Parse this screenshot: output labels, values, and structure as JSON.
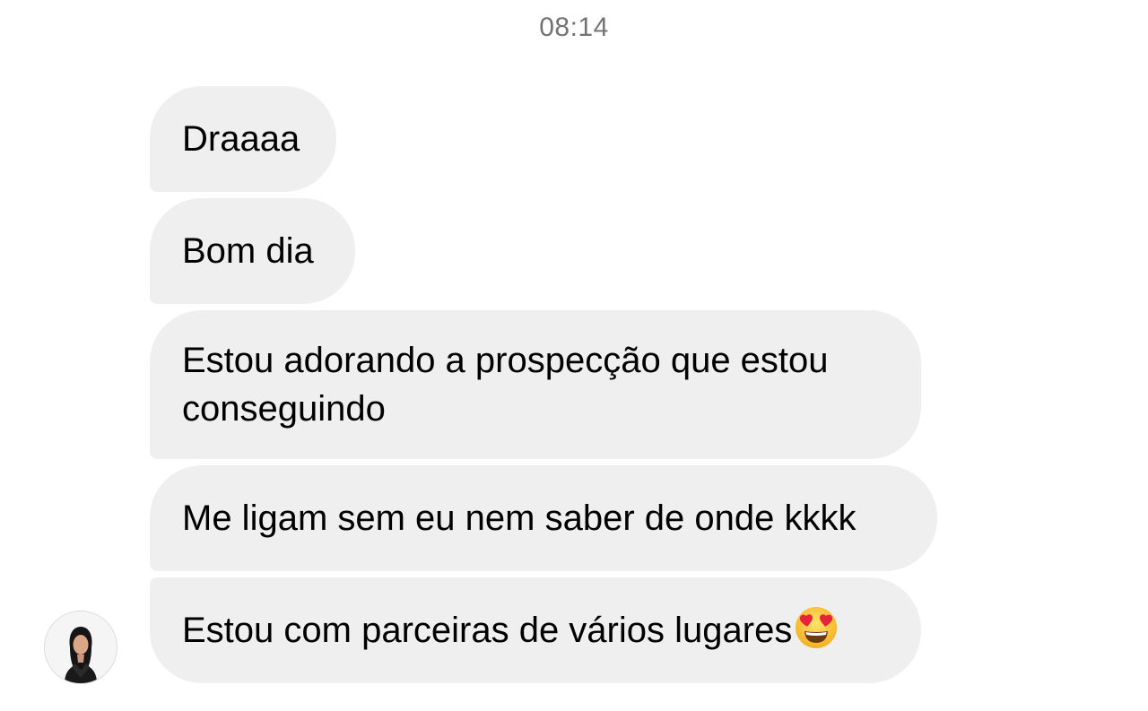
{
  "conversation": {
    "timestamp": "08:14",
    "messages": [
      {
        "text": "Draaaa"
      },
      {
        "text": "Bom dia"
      },
      {
        "text": "Estou adorando a prospecção que estou conseguindo"
      },
      {
        "text": "Me ligam sem eu nem saber de onde kkkk"
      },
      {
        "text": "Estou com parceiras de vários lugares",
        "emoji": "heart-eyes-emoji"
      }
    ]
  },
  "colors": {
    "bubble_background": "#efefef",
    "timestamp_text": "#737373",
    "message_text": "#000000"
  },
  "icons": {
    "avatar": "sender-profile-photo",
    "emoji": "smiling-face-with-heart-eyes"
  }
}
